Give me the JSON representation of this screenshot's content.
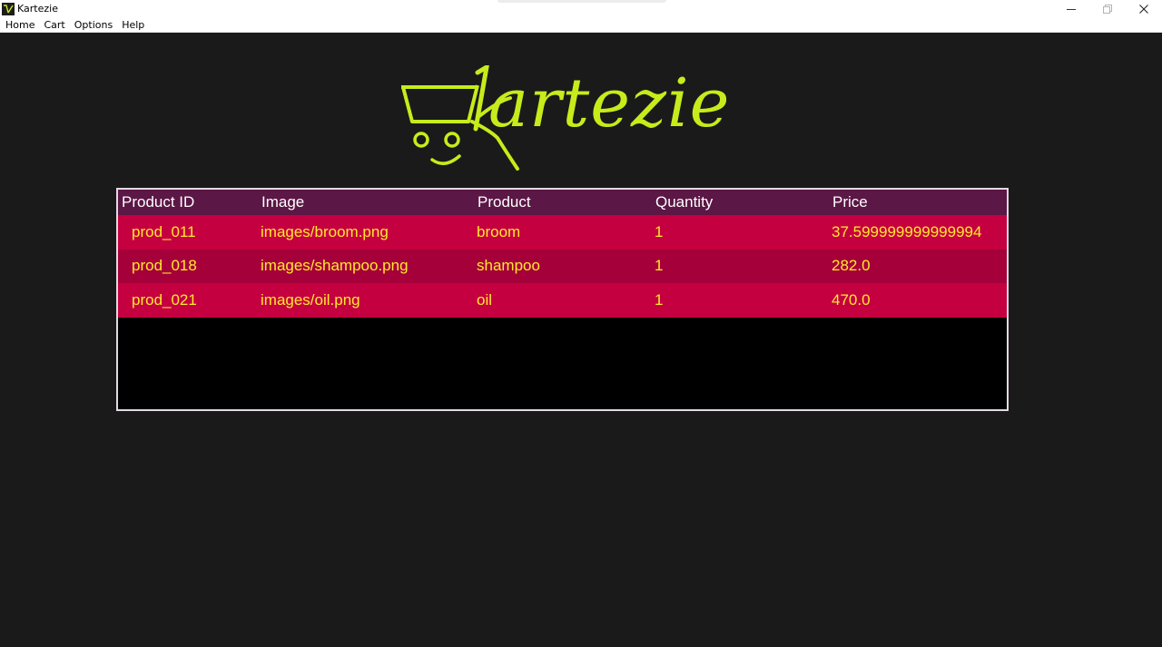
{
  "window": {
    "title": "Kartezie"
  },
  "menu": [
    "Home",
    "Cart",
    "Options",
    "Help"
  ],
  "logo": {
    "text": "kartezie",
    "color": "#c6ec1b"
  },
  "table": {
    "columns": [
      "Product ID",
      "Image",
      "Product",
      "Quantity",
      "Price"
    ],
    "rows": [
      [
        "prod_011",
        "images/broom.png",
        "broom",
        "1",
        "37.599999999999994"
      ],
      [
        "prod_018",
        "images/shampoo.png",
        "shampoo",
        "1",
        "282.0"
      ],
      [
        "prod_021",
        "images/oil.png",
        "oil",
        "1",
        "470.0"
      ]
    ]
  },
  "colors": {
    "background": "#1a1a1a",
    "header_bg": "#5b1745",
    "row_odd": "#c50040",
    "row_even": "#a5003a",
    "cell_text": "#ffe92b",
    "accent": "#c6ec1b"
  },
  "icons": {
    "app": "kartezie-app-icon",
    "minimize": "minimize-icon",
    "restore": "restore-icon",
    "close": "close-icon",
    "cart": "shopping-cart-icon"
  }
}
